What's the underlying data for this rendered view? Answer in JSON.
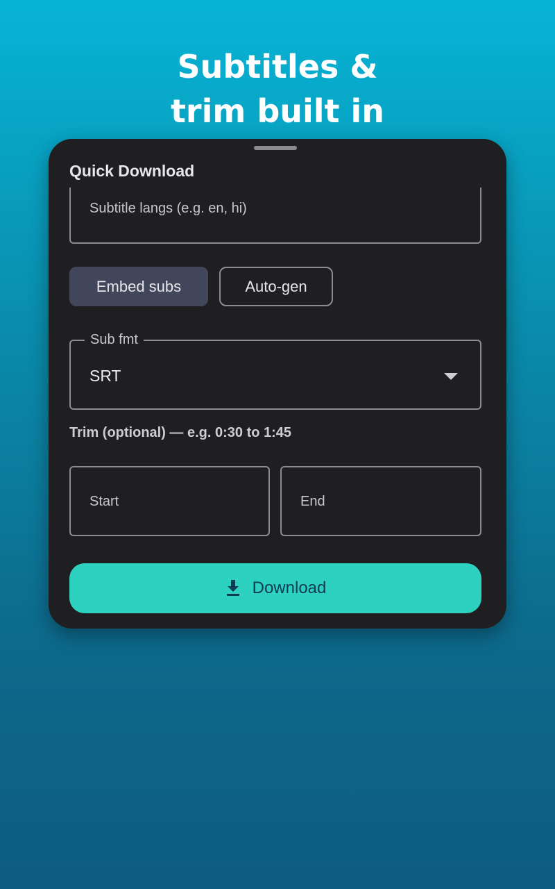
{
  "headline": {
    "line1": "Subtitles &",
    "line2": "trim built in"
  },
  "sheet": {
    "title": "Quick Download",
    "subtitle_langs": {
      "placeholder": "Subtitle langs (e.g. en, hi)"
    },
    "chips": {
      "embed_subs": "Embed subs",
      "auto_gen": "Auto-gen"
    },
    "sub_format": {
      "label": "Sub fmt",
      "value": "SRT"
    },
    "trim": {
      "label": "Trim (optional) — e.g. 0:30 to 1:45",
      "start_placeholder": "Start",
      "end_placeholder": "End"
    },
    "download_button": {
      "label": "Download",
      "icon": "download-icon"
    }
  },
  "colors": {
    "accent": "#2dd1c0",
    "sheet_bg": "#1f1e21",
    "chip_selected": "#42465a"
  }
}
